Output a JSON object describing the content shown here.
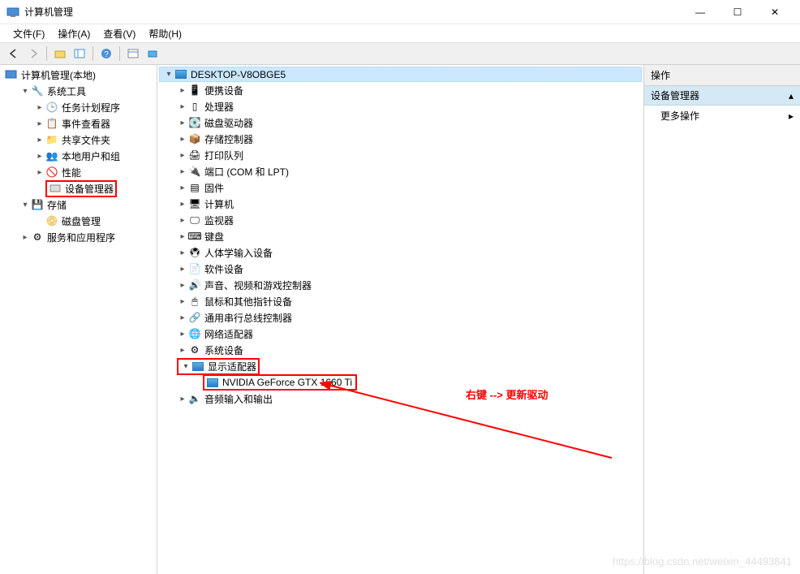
{
  "window": {
    "title": "计算机管理",
    "min": "—",
    "max": "☐",
    "close": "✕"
  },
  "menu": {
    "file": "文件(F)",
    "action": "操作(A)",
    "view": "查看(V)",
    "help": "帮助(H)"
  },
  "left_tree": {
    "root": "计算机管理(本地)",
    "system_tools": "系统工具",
    "task_scheduler": "任务计划程序",
    "event_viewer": "事件查看器",
    "shared_folders": "共享文件夹",
    "local_users": "本地用户和组",
    "performance": "性能",
    "device_manager": "设备管理器",
    "storage": "存储",
    "disk_mgmt": "磁盘管理",
    "services_apps": "服务和应用程序"
  },
  "devices": {
    "root": "DESKTOP-V8OBGE5",
    "items": [
      "便携设备",
      "处理器",
      "磁盘驱动器",
      "存储控制器",
      "打印队列",
      "端口 (COM 和 LPT)",
      "固件",
      "计算机",
      "监视器",
      "键盘",
      "人体学输入设备",
      "软件设备",
      "声音、视频和游戏控制器",
      "鼠标和其他指针设备",
      "通用串行总线控制器",
      "网络适配器",
      "系统设备"
    ],
    "display_adapters": "显示适配器",
    "gpu": "NVIDIA GeForce GTX 1660 Ti",
    "audio_io": "音频输入和输出"
  },
  "actions": {
    "header": "操作",
    "section": "设备管理器",
    "more": "更多操作"
  },
  "annotation": {
    "text": "右键 --> 更新驱动"
  },
  "watermark": "https://blog.csdn.net/weixin_44493841"
}
